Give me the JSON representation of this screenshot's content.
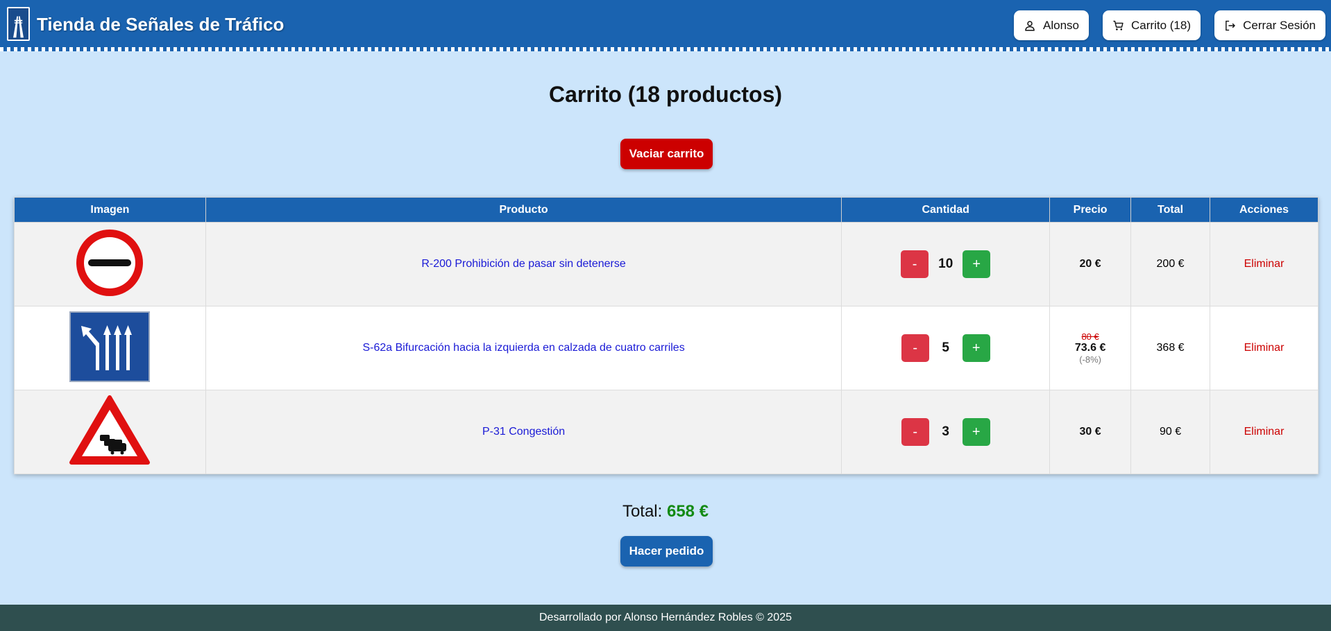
{
  "header": {
    "title": "Tienda de Señales de Tráfico",
    "user_label": "Alonso",
    "cart_label": "Carrito (18)",
    "logout_label": "Cerrar Sesión",
    "icons": {
      "logo": "motorway-sign-icon",
      "user": "person-icon",
      "cart": "cart-icon",
      "logout": "logout-icon"
    }
  },
  "main": {
    "title": "Carrito (18 productos)",
    "empty_button": "Vaciar carrito",
    "table": {
      "headers": [
        "Imagen",
        "Producto",
        "Cantidad",
        "Precio",
        "Total",
        "Acciones"
      ],
      "rows": [
        {
          "image": "no-passing-without-stopping-sign",
          "product": "R-200 Prohibición de pasar sin detenerse",
          "minus": "-",
          "quantity": "10",
          "plus": "+",
          "price": "20 €",
          "total": "200 €",
          "action": "Eliminar"
        },
        {
          "image": "lane-fork-left-sign",
          "product": "S-62a Bifurcación hacia la izquierda en calzada de cuatro carriles",
          "minus": "-",
          "quantity": "5",
          "plus": "+",
          "old_price": "80 €",
          "price": "73.6 €",
          "discount": "(-8%)",
          "total": "368 €",
          "action": "Eliminar"
        },
        {
          "image": "congestion-warning-sign",
          "product": "P-31 Congestión",
          "minus": "-",
          "quantity": "3",
          "plus": "+",
          "price": "30 €",
          "total": "90 €",
          "action": "Eliminar"
        }
      ]
    },
    "total_label": "Total:",
    "total_amount": "658 €",
    "order_button": "Hacer pedido"
  },
  "footer": {
    "text": "Desarrollado por Alonso Hernández Robles © 2025"
  },
  "colors": {
    "header": "#1a63b0",
    "background": "#cce5fb",
    "danger": "#cc0000",
    "minus": "#dc3545",
    "plus": "#28a745",
    "total": "#138a13",
    "footer": "#2f4f4f"
  }
}
